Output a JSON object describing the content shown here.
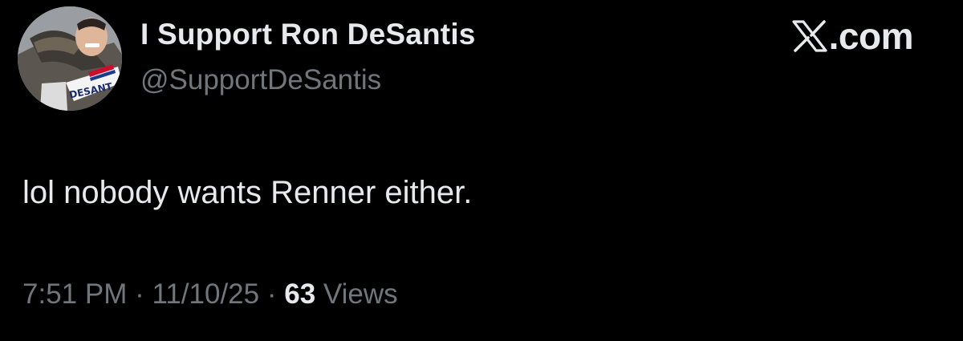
{
  "post": {
    "author": {
      "display_name": "I Support Ron DeSantis",
      "handle": "@SupportDeSantis",
      "avatar_sign_text": "DESANT"
    },
    "brand": {
      "icon": "x-logo-icon",
      "text": ".com"
    },
    "text": "lol nobody wants Renner either.",
    "meta": {
      "time": "7:51 PM",
      "separator": " · ",
      "date": "11/10/25",
      "views_count": "63",
      "views_label": "Views"
    }
  },
  "colors": {
    "background": "#000000",
    "primary_text": "#e7e9ea",
    "secondary_text": "#71767b"
  }
}
